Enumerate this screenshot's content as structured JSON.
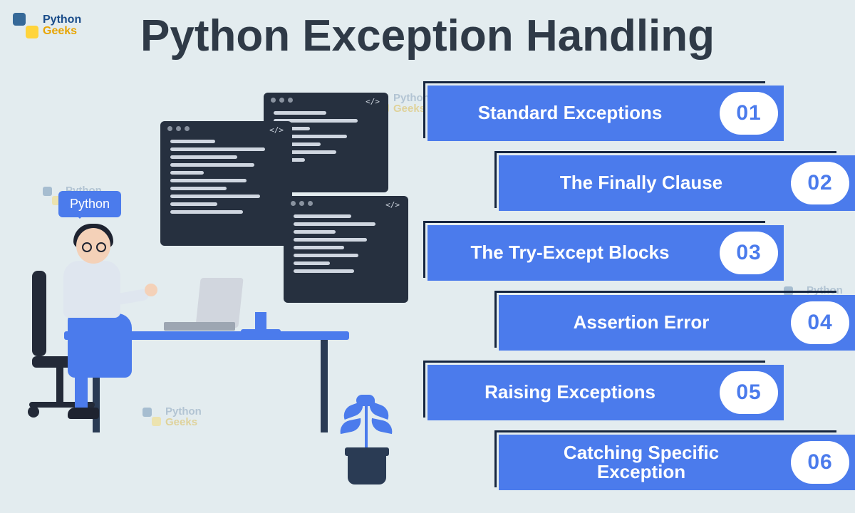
{
  "brand": {
    "line1": "Python",
    "line2": "Geeks"
  },
  "title": "Python Exception Handling",
  "speech_label": "Python",
  "code_tag": "</>",
  "topics": [
    {
      "number": "01",
      "label": "Standard Exceptions"
    },
    {
      "number": "02",
      "label": "The Finally Clause"
    },
    {
      "number": "03",
      "label": "The Try-Except Blocks"
    },
    {
      "number": "04",
      "label": "Assertion Error"
    },
    {
      "number": "05",
      "label": "Raising Exceptions"
    },
    {
      "number": "06",
      "label": "Catching Specific Exception"
    }
  ],
  "watermark": {
    "line1": "Python",
    "line2": "Geeks"
  },
  "colors": {
    "accent": "#4b7bec",
    "dark": "#2a3b54",
    "bg": "#e3ecef",
    "title": "#2f3a47"
  }
}
